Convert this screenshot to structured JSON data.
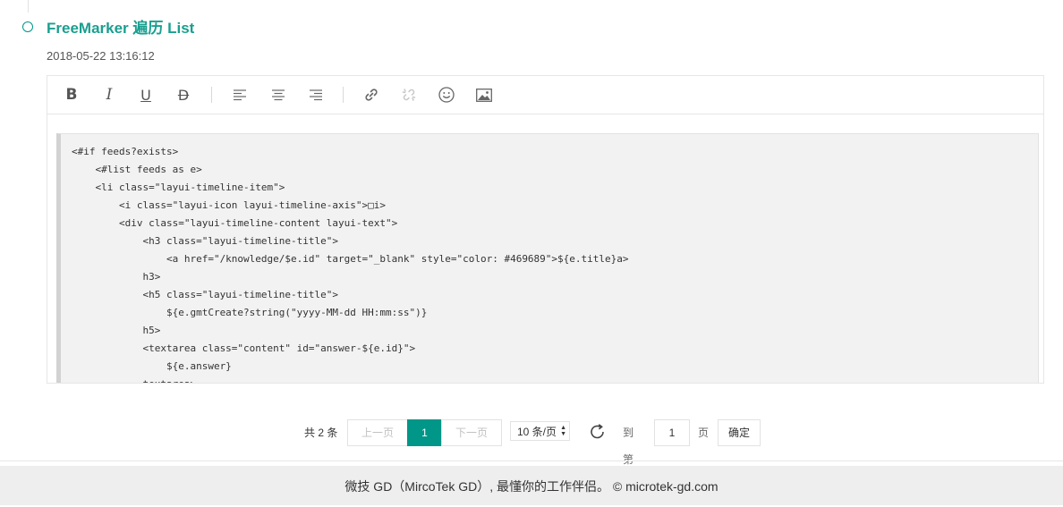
{
  "post": {
    "title": "FreeMarker 遍历 List",
    "timestamp": "2018-05-22 13:16:12"
  },
  "toolbar": {
    "bold": "B",
    "italic": "I",
    "underline": "U",
    "strike": "D",
    "icons": [
      "bold-icon",
      "italic-icon",
      "underline-icon",
      "strikethrough-icon",
      "align-left-icon",
      "align-center-icon",
      "align-right-icon",
      "link-icon",
      "unlink-icon",
      "emoji-icon",
      "image-icon"
    ]
  },
  "code": {
    "lines": [
      "<#if feeds?exists>",
      "    <#list feeds as e>",
      "    <li class=\"layui-timeline-item\">",
      "        <i class=\"layui-icon layui-timeline-axis\">□i>",
      "        <div class=\"layui-timeline-content layui-text\">",
      "            <h3 class=\"layui-timeline-title\">",
      "                <a href=\"/knowledge/$e.id\" target=\"_blank\" style=\"color: #469689\">${e.title}a>",
      "            h3>",
      "            <h5 class=\"layui-timeline-title\">",
      "                ${e.gmtCreate?string(\"yyyy-MM-dd HH:mm:ss\")}",
      "            h5>",
      "            <textarea class=\"content\" id=\"answer-${e.id}\">",
      "                ${e.answer}",
      "            textarea>"
    ]
  },
  "pagination": {
    "count_label": "共 2 条",
    "prev": "上一页",
    "current": "1",
    "next": "下一页",
    "limit": "10 条/页",
    "goto_label": "到第",
    "page_input": "1",
    "page_unit": "页",
    "confirm": "确定"
  },
  "footer": {
    "text": "微技 GD（MircoTek GD）, 最懂你的工作伴侣。 © microtek-gd.com"
  },
  "colors": {
    "accent": "#009688",
    "title": "#1a9f8f"
  }
}
